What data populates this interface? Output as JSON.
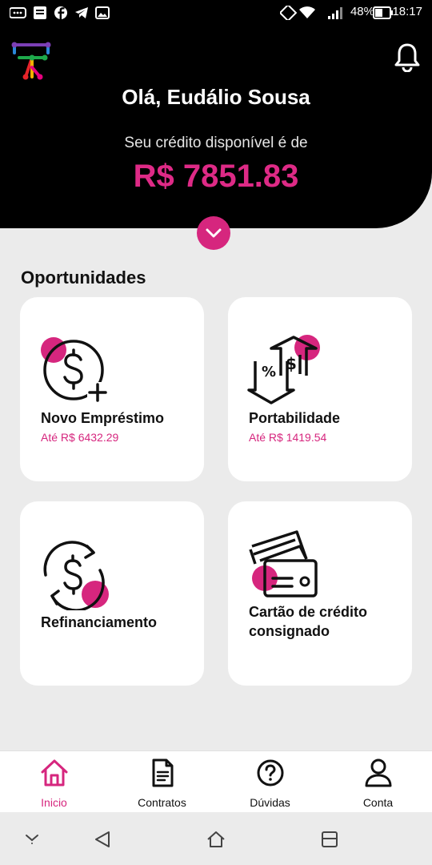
{
  "status_bar": {
    "battery": "48%",
    "time": "18:17"
  },
  "header": {
    "greeting": "Olá, Eudálio Sousa",
    "credit_label": "Seu crédito disponível é de",
    "credit_amount": "R$ 7851.83"
  },
  "opportunities": {
    "title": "Oportunidades",
    "cards": [
      {
        "title": "Novo Empréstimo",
        "amount": "Até R$ 6432.29",
        "icon": "money-plus-icon"
      },
      {
        "title": "Portabilidade",
        "amount": "Até R$ 1419.54",
        "icon": "transfer-arrows-icon"
      },
      {
        "title": "Refinanciamento",
        "amount": "",
        "icon": "money-refresh-icon"
      },
      {
        "title": "Cartão de crédito consignado",
        "amount": "",
        "icon": "credit-cards-icon"
      }
    ]
  },
  "bottom_nav": {
    "items": [
      {
        "label": "Inicio",
        "icon": "home-icon",
        "active": true
      },
      {
        "label": "Contratos",
        "icon": "document-icon",
        "active": false
      },
      {
        "label": "Dúvidas",
        "icon": "question-icon",
        "active": false
      },
      {
        "label": "Conta",
        "icon": "user-icon",
        "active": false
      }
    ]
  },
  "colors": {
    "accent": "#d6267e",
    "header_bg": "#000000",
    "page_bg": "#ebebeb"
  }
}
